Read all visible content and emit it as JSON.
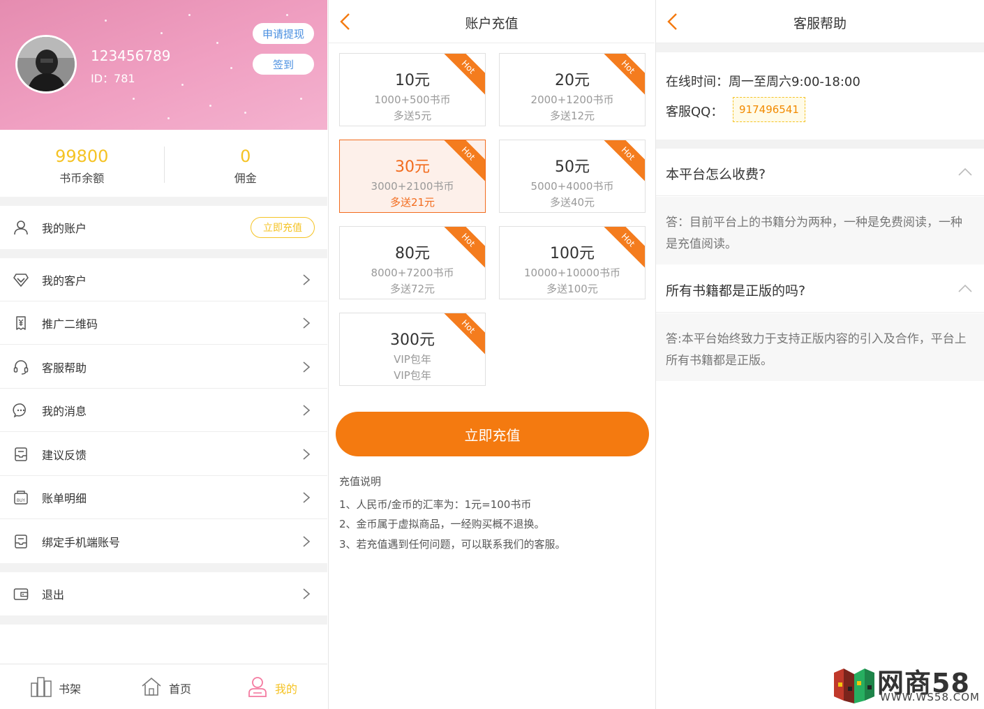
{
  "profile": {
    "username": "123456789",
    "id_label": "ID：",
    "id_value": "781",
    "withdraw_label": "申请提现",
    "signin_label": "签到"
  },
  "stats": {
    "balance_value": "99800",
    "balance_label": "书币余额",
    "commission_value": "0",
    "commission_label": "佣金"
  },
  "account": {
    "label": "我的账户",
    "recharge_label": "立即充值"
  },
  "menu": [
    {
      "label": "我的客户",
      "icon": "diamond-icon"
    },
    {
      "label": "推广二维码",
      "icon": "yuan-tag-icon"
    },
    {
      "label": "客服帮助",
      "icon": "headset-icon"
    },
    {
      "label": "我的消息",
      "icon": "chat-bubble-icon"
    },
    {
      "label": "建议反馈",
      "icon": "inbox-icon"
    },
    {
      "label": "账单明细",
      "icon": "buy-receipt-icon"
    },
    {
      "label": "绑定手机端账号",
      "icon": "inbox-icon"
    }
  ],
  "logout_label": "退出",
  "tabbar": [
    {
      "label": "书架",
      "icon": "bookshelf-icon"
    },
    {
      "label": "首页",
      "icon": "home-icon"
    },
    {
      "label": "我的",
      "icon": "user-icon"
    }
  ],
  "recharge": {
    "title": "账户充值",
    "hot_label": "Hot",
    "cards": [
      {
        "amount": "10元",
        "coins": "1000+500书币",
        "bonus": "多送5元"
      },
      {
        "amount": "20元",
        "coins": "2000+1200书币",
        "bonus": "多送12元"
      },
      {
        "amount": "30元",
        "coins": "3000+2100书币",
        "bonus": "多送21元"
      },
      {
        "amount": "50元",
        "coins": "5000+4000书币",
        "bonus": "多送40元"
      },
      {
        "amount": "80元",
        "coins": "8000+7200书币",
        "bonus": "多送72元"
      },
      {
        "amount": "100元",
        "coins": "10000+10000书币",
        "bonus": "多送100元"
      },
      {
        "amount": "300元",
        "coins": "VIP包年",
        "bonus": "VIP包年"
      }
    ],
    "button_label": "立即充值",
    "notes_title": "充值说明",
    "notes": [
      "1、人民币/金币的汇率为：1元=100书币",
      "2、金币属于虚拟商品，一经购买概不退换。",
      "3、若充值遇到任何问题，可以联系我们的客服。"
    ],
    "accent_color": "#f47a10"
  },
  "support": {
    "title": "客服帮助",
    "online_time": "在线时间：周一至周六9:00-18:00",
    "qq_label": "客服QQ：",
    "qq_value": "917496541",
    "faqs": [
      {
        "q": "本平台怎么收费?",
        "a": "答：目前平台上的书籍分为两种，一种是免费阅读，一种是充值阅读。"
      },
      {
        "q": "所有书籍都是正版的吗?",
        "a": "答:本平台始终致力于支持正版内容的引入及合作，平台上所有书籍都是正版。"
      }
    ]
  },
  "watermark": {
    "text": "网商58",
    "url": "WWW.WS58.COM"
  }
}
